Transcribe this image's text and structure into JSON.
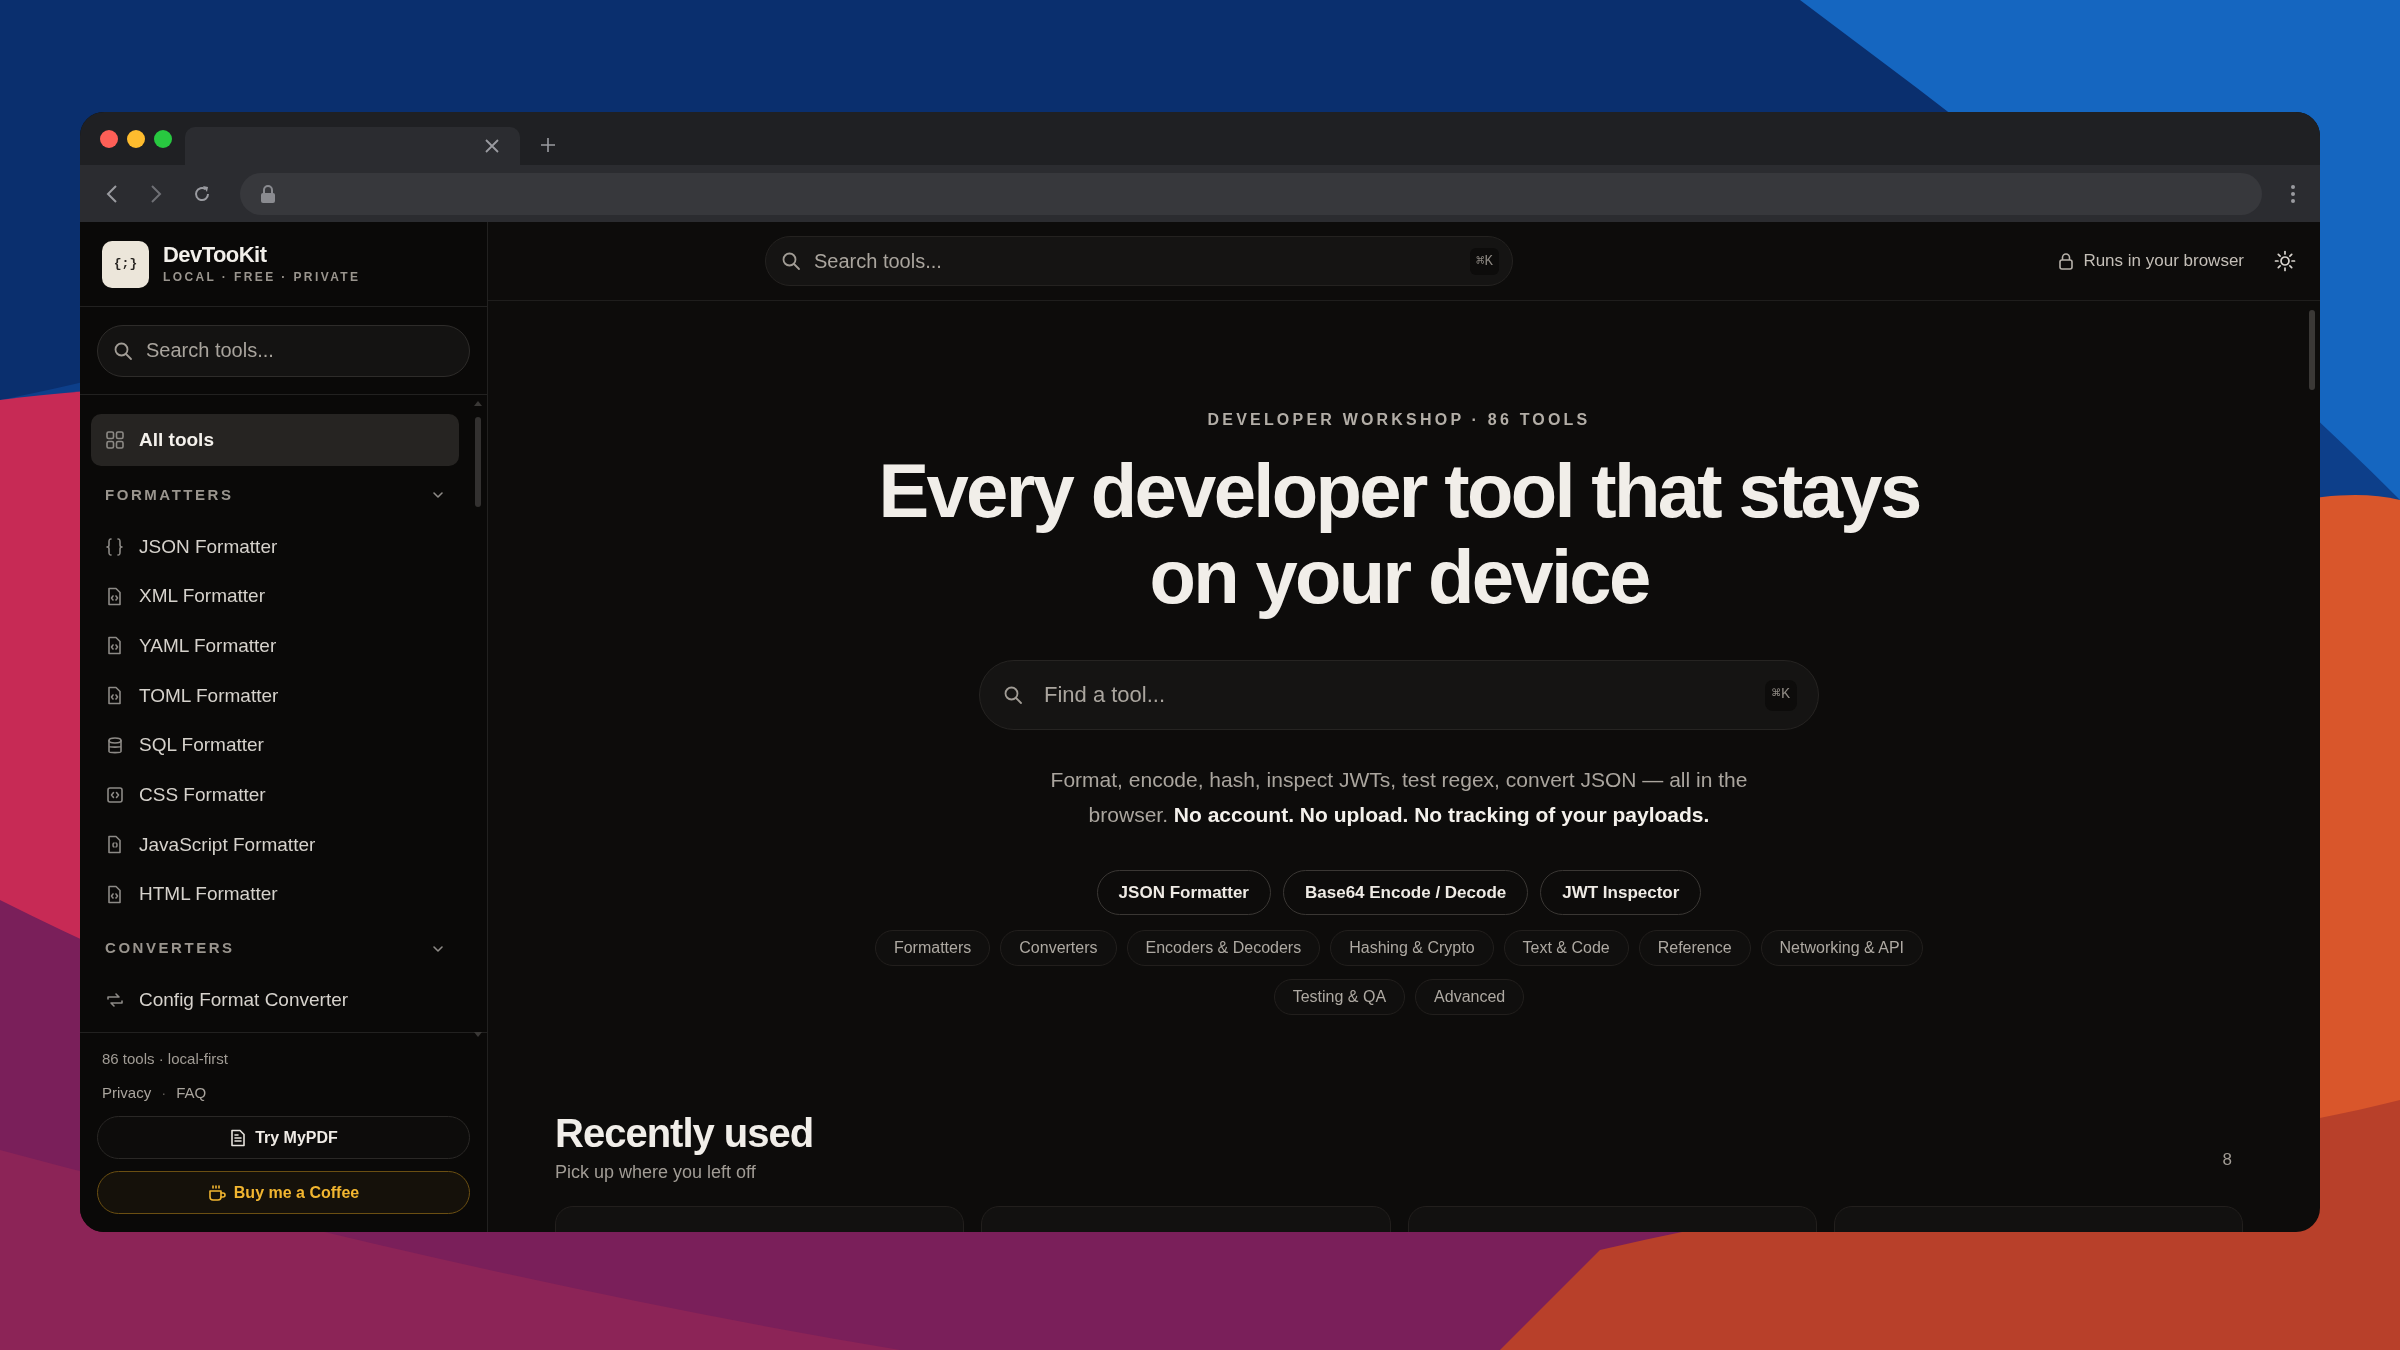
{
  "sidebar": {
    "brand": {
      "logo": "{;}",
      "name": "DevTooKit",
      "tagline": "LOCAL · FREE · PRIVATE"
    },
    "search": {
      "placeholder": "Search tools..."
    },
    "nav": [
      {
        "kind": "link",
        "label": "All tools",
        "selected": true
      },
      {
        "kind": "section",
        "label": "FORMATTERS",
        "expanded": true,
        "children": [
          {
            "label": "JSON Formatter",
            "selected": false
          },
          {
            "label": "XML Formatter",
            "selected": false
          },
          {
            "label": "YAML Formatter",
            "selected": false
          },
          {
            "label": "TOML Formatter",
            "selected": false
          },
          {
            "label": "SQL Formatter",
            "selected": false
          },
          {
            "label": "CSS Formatter",
            "selected": false
          },
          {
            "label": "JavaScript Formatter",
            "selected": false
          },
          {
            "label": "HTML Formatter",
            "selected": false
          }
        ]
      },
      {
        "kind": "section",
        "label": "CONVERTERS",
        "expanded": true,
        "children": [
          {
            "label": "Config Format Converter",
            "selected": false
          }
        ]
      }
    ],
    "footer": {
      "stats": "86 tools · local-first",
      "links": [
        "Privacy",
        "FAQ"
      ],
      "separator": "·",
      "buttons": [
        {
          "kind": "plain",
          "label": "Try MyPDF"
        },
        {
          "kind": "accent",
          "label": "Buy me a Coffee"
        }
      ]
    }
  },
  "topbar": {
    "search": {
      "placeholder": "Search tools...",
      "shortcut": "⌘K"
    },
    "status": "Runs in your browser"
  },
  "hero": {
    "eyebrow": "DEVELOPER WORKSHOP · 86 TOOLS",
    "headline_lines": [
      "Every developer tool that stays",
      "on your device"
    ],
    "search": {
      "placeholder": "Find a tool...",
      "shortcut": "⌘K"
    },
    "description": "Format, encode, hash, inspect JWTs, test regex, convert JSON — all in the browser. **No account. No upload. No tracking of your payloads.**",
    "quick_links": [
      "JSON Formatter",
      "Base64 Encode / Decode",
      "JWT Inspector"
    ],
    "categories": [
      "Formatters",
      "Converters",
      "Encoders & Decoders",
      "Hashing & Crypto",
      "Text & Code",
      "Reference",
      "Networking & API",
      "Testing & QA",
      "Advanced"
    ]
  },
  "recent": {
    "title": "Recently used",
    "subtitle": "Pick up where you left off",
    "count": "8"
  }
}
